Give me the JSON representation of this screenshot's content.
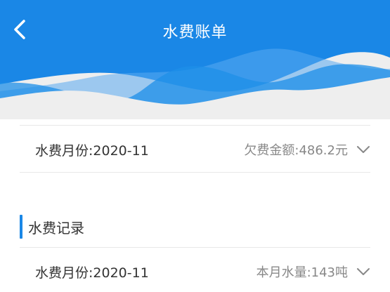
{
  "header": {
    "title": "水费账单",
    "back_icon": "chevron-left-icon",
    "accent_color": "#1a87e6"
  },
  "bill": {
    "month_label": "水费月份:2020-11",
    "arrears_label": "欠费金额:486.2元"
  },
  "records": {
    "section_title": "水费记录",
    "items": [
      {
        "month_label": "水费月份:2020-11",
        "usage_label": "本月水量:143吨"
      }
    ]
  }
}
